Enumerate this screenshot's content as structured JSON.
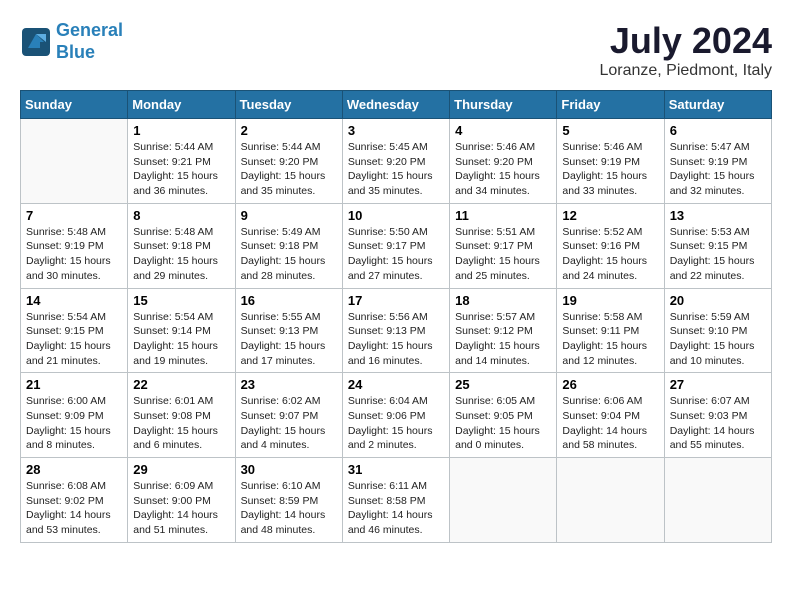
{
  "header": {
    "logo_line1": "General",
    "logo_line2": "Blue",
    "month_title": "July 2024",
    "location": "Loranze, Piedmont, Italy"
  },
  "columns": [
    "Sunday",
    "Monday",
    "Tuesday",
    "Wednesday",
    "Thursday",
    "Friday",
    "Saturday"
  ],
  "weeks": [
    [
      {
        "day": "",
        "info": ""
      },
      {
        "day": "1",
        "info": "Sunrise: 5:44 AM\nSunset: 9:21 PM\nDaylight: 15 hours\nand 36 minutes."
      },
      {
        "day": "2",
        "info": "Sunrise: 5:44 AM\nSunset: 9:20 PM\nDaylight: 15 hours\nand 35 minutes."
      },
      {
        "day": "3",
        "info": "Sunrise: 5:45 AM\nSunset: 9:20 PM\nDaylight: 15 hours\nand 35 minutes."
      },
      {
        "day": "4",
        "info": "Sunrise: 5:46 AM\nSunset: 9:20 PM\nDaylight: 15 hours\nand 34 minutes."
      },
      {
        "day": "5",
        "info": "Sunrise: 5:46 AM\nSunset: 9:19 PM\nDaylight: 15 hours\nand 33 minutes."
      },
      {
        "day": "6",
        "info": "Sunrise: 5:47 AM\nSunset: 9:19 PM\nDaylight: 15 hours\nand 32 minutes."
      }
    ],
    [
      {
        "day": "7",
        "info": "Sunrise: 5:48 AM\nSunset: 9:19 PM\nDaylight: 15 hours\nand 30 minutes."
      },
      {
        "day": "8",
        "info": "Sunrise: 5:48 AM\nSunset: 9:18 PM\nDaylight: 15 hours\nand 29 minutes."
      },
      {
        "day": "9",
        "info": "Sunrise: 5:49 AM\nSunset: 9:18 PM\nDaylight: 15 hours\nand 28 minutes."
      },
      {
        "day": "10",
        "info": "Sunrise: 5:50 AM\nSunset: 9:17 PM\nDaylight: 15 hours\nand 27 minutes."
      },
      {
        "day": "11",
        "info": "Sunrise: 5:51 AM\nSunset: 9:17 PM\nDaylight: 15 hours\nand 25 minutes."
      },
      {
        "day": "12",
        "info": "Sunrise: 5:52 AM\nSunset: 9:16 PM\nDaylight: 15 hours\nand 24 minutes."
      },
      {
        "day": "13",
        "info": "Sunrise: 5:53 AM\nSunset: 9:15 PM\nDaylight: 15 hours\nand 22 minutes."
      }
    ],
    [
      {
        "day": "14",
        "info": "Sunrise: 5:54 AM\nSunset: 9:15 PM\nDaylight: 15 hours\nand 21 minutes."
      },
      {
        "day": "15",
        "info": "Sunrise: 5:54 AM\nSunset: 9:14 PM\nDaylight: 15 hours\nand 19 minutes."
      },
      {
        "day": "16",
        "info": "Sunrise: 5:55 AM\nSunset: 9:13 PM\nDaylight: 15 hours\nand 17 minutes."
      },
      {
        "day": "17",
        "info": "Sunrise: 5:56 AM\nSunset: 9:13 PM\nDaylight: 15 hours\nand 16 minutes."
      },
      {
        "day": "18",
        "info": "Sunrise: 5:57 AM\nSunset: 9:12 PM\nDaylight: 15 hours\nand 14 minutes."
      },
      {
        "day": "19",
        "info": "Sunrise: 5:58 AM\nSunset: 9:11 PM\nDaylight: 15 hours\nand 12 minutes."
      },
      {
        "day": "20",
        "info": "Sunrise: 5:59 AM\nSunset: 9:10 PM\nDaylight: 15 hours\nand 10 minutes."
      }
    ],
    [
      {
        "day": "21",
        "info": "Sunrise: 6:00 AM\nSunset: 9:09 PM\nDaylight: 15 hours\nand 8 minutes."
      },
      {
        "day": "22",
        "info": "Sunrise: 6:01 AM\nSunset: 9:08 PM\nDaylight: 15 hours\nand 6 minutes."
      },
      {
        "day": "23",
        "info": "Sunrise: 6:02 AM\nSunset: 9:07 PM\nDaylight: 15 hours\nand 4 minutes."
      },
      {
        "day": "24",
        "info": "Sunrise: 6:04 AM\nSunset: 9:06 PM\nDaylight: 15 hours\nand 2 minutes."
      },
      {
        "day": "25",
        "info": "Sunrise: 6:05 AM\nSunset: 9:05 PM\nDaylight: 15 hours\nand 0 minutes."
      },
      {
        "day": "26",
        "info": "Sunrise: 6:06 AM\nSunset: 9:04 PM\nDaylight: 14 hours\nand 58 minutes."
      },
      {
        "day": "27",
        "info": "Sunrise: 6:07 AM\nSunset: 9:03 PM\nDaylight: 14 hours\nand 55 minutes."
      }
    ],
    [
      {
        "day": "28",
        "info": "Sunrise: 6:08 AM\nSunset: 9:02 PM\nDaylight: 14 hours\nand 53 minutes."
      },
      {
        "day": "29",
        "info": "Sunrise: 6:09 AM\nSunset: 9:00 PM\nDaylight: 14 hours\nand 51 minutes."
      },
      {
        "day": "30",
        "info": "Sunrise: 6:10 AM\nSunset: 8:59 PM\nDaylight: 14 hours\nand 48 minutes."
      },
      {
        "day": "31",
        "info": "Sunrise: 6:11 AM\nSunset: 8:58 PM\nDaylight: 14 hours\nand 46 minutes."
      },
      {
        "day": "",
        "info": ""
      },
      {
        "day": "",
        "info": ""
      },
      {
        "day": "",
        "info": ""
      }
    ]
  ]
}
